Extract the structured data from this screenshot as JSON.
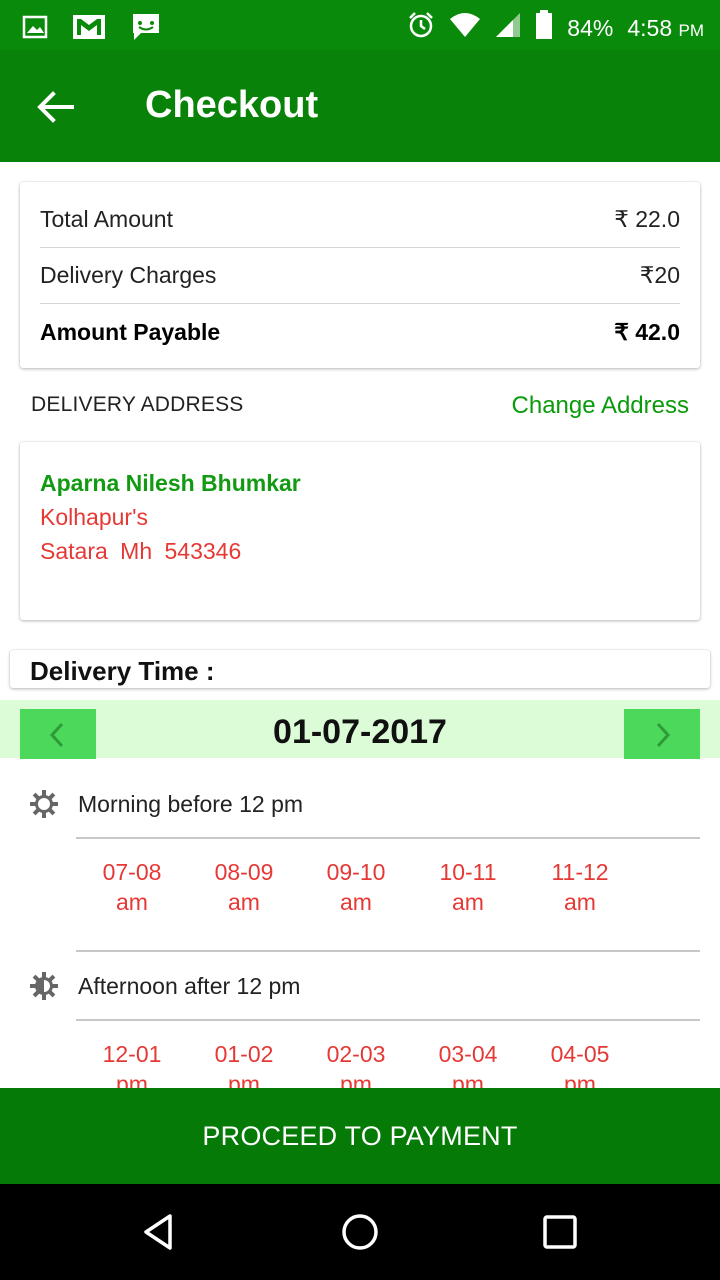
{
  "status_bar": {
    "battery": "84%",
    "time": "4:58",
    "ampm": "PM",
    "icons": [
      "image-icon",
      "gmail-icon",
      "message-icon",
      "alarm-icon",
      "wifi-icon",
      "signal-icon",
      "battery-icon"
    ]
  },
  "app_bar": {
    "title": "Checkout"
  },
  "summary": {
    "rows": [
      {
        "label": "Total Amount",
        "value": "₹ 22.0"
      },
      {
        "label": "Delivery Charges",
        "value": "₹20"
      },
      {
        "label": "Amount Payable",
        "value": "₹ 42.0"
      }
    ]
  },
  "address": {
    "heading": "DELIVERY ADDRESS",
    "change_label": "Change Address",
    "name": "Aparna Nilesh Bhumkar",
    "line1": "Kolhapur's",
    "line2": "Satara  Mh  543346"
  },
  "delivery_time": {
    "heading": "Delivery Time :",
    "date": "01-07-2017",
    "sections": [
      {
        "title": "Morning before 12 pm",
        "icon": "sun-outline-icon",
        "slots": [
          {
            "range": "07-08",
            "period": "am"
          },
          {
            "range": "08-09",
            "period": "am"
          },
          {
            "range": "09-10",
            "period": "am"
          },
          {
            "range": "10-11",
            "period": "am"
          },
          {
            "range": "11-12",
            "period": "am"
          }
        ]
      },
      {
        "title": "Afternoon after 12 pm",
        "icon": "sun-half-icon",
        "slots": [
          {
            "range": "12-01",
            "period": "pm"
          },
          {
            "range": "01-02",
            "period": "pm"
          },
          {
            "range": "02-03",
            "period": "pm"
          },
          {
            "range": "03-04",
            "period": "pm"
          },
          {
            "range": "04-05",
            "period": "pm"
          }
        ]
      }
    ]
  },
  "proceed_label": "PROCEED TO PAYMENT",
  "colors": {
    "primary": "#088208",
    "accent_green": "#0a9a0a",
    "slot_red": "#e53935",
    "date_bar": "#dcfcd8",
    "nav_button": "#4cd85a"
  }
}
